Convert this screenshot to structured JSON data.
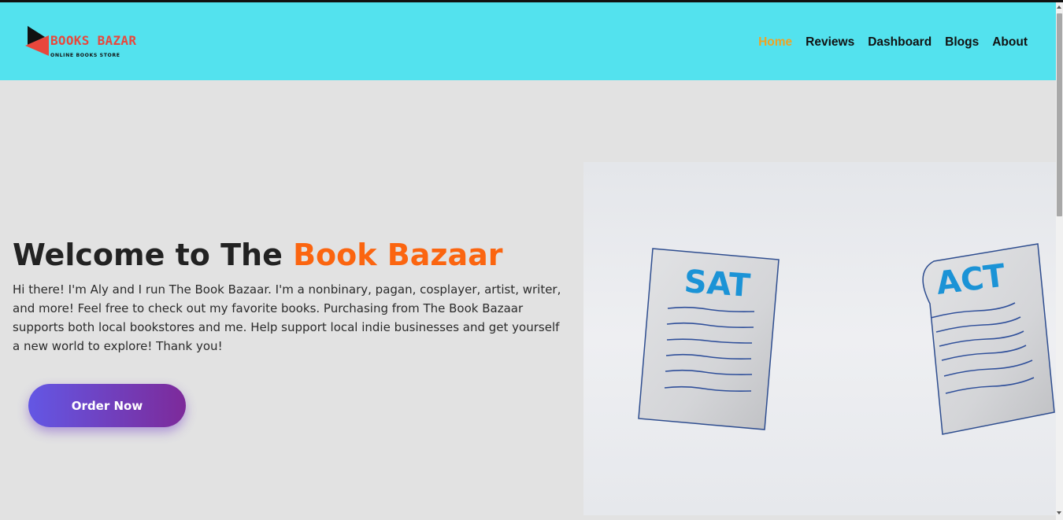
{
  "brand": {
    "title": "BOOKS BAZAR",
    "subtitle": "ONLINE BOOKS STORE"
  },
  "nav": {
    "items": [
      {
        "label": "Home",
        "active": true
      },
      {
        "label": "Reviews",
        "active": false
      },
      {
        "label": "Dashboard",
        "active": false
      },
      {
        "label": "Blogs",
        "active": false
      },
      {
        "label": "About",
        "active": false
      }
    ]
  },
  "hero": {
    "title_prefix": "Welcome to The ",
    "title_accent": "Book Bazaar",
    "description": "Hi there! I'm Aly and I run The Book Bazaar. I'm a nonbinary, pagan, cosplayer, artist, writer, and more! Feel free to check out my favorite books. Purchasing from The Book Bazaar supports both local bookstores and me. Help support local indie businesses and get yourself a new world to explore! Thank you!",
    "button_label": "Order Now"
  },
  "illustration": {
    "left_sheet": "SAT",
    "right_sheet": "ACT"
  },
  "colors": {
    "header_bg": "#53e2ee",
    "nav_active": "#f2a221",
    "accent": "#fb6510",
    "button_gradient_start": "#6357e4",
    "button_gradient_end": "#7d2a9a",
    "page_bg": "#e2e2e2"
  }
}
